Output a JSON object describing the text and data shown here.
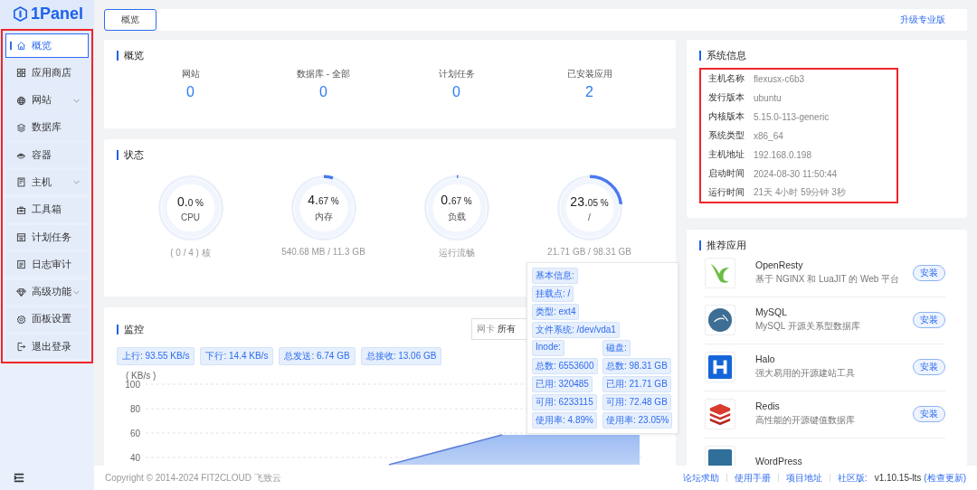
{
  "brand": {
    "name": "1Panel"
  },
  "sidebar": {
    "highlighted": true,
    "items": [
      {
        "label": "概览",
        "selected": true,
        "expandable": false
      },
      {
        "label": "应用商店",
        "selected": false,
        "expandable": false
      },
      {
        "label": "网站",
        "selected": false,
        "expandable": true
      },
      {
        "label": "数据库",
        "selected": false,
        "expandable": false
      },
      {
        "label": "容器",
        "selected": false,
        "expandable": false
      },
      {
        "label": "主机",
        "selected": false,
        "expandable": true
      },
      {
        "label": "工具箱",
        "selected": false,
        "expandable": false
      },
      {
        "label": "计划任务",
        "selected": false,
        "expandable": false
      },
      {
        "label": "日志审计",
        "selected": false,
        "expandable": false
      },
      {
        "label": "高级功能",
        "selected": false,
        "expandable": true
      },
      {
        "label": "面板设置",
        "selected": false,
        "expandable": false
      },
      {
        "label": "退出登录",
        "selected": false,
        "expandable": false
      }
    ]
  },
  "topbar": {
    "tabs": [
      {
        "label": "概览",
        "selected": true
      }
    ],
    "upgrade_link": "升级专业版"
  },
  "overview": {
    "title": "概览",
    "stats": [
      {
        "label": "网站",
        "value": "0"
      },
      {
        "label": "数据库 - 全部",
        "value": "0"
      },
      {
        "label": "计划任务",
        "value": "0"
      },
      {
        "label": "已安装应用",
        "value": "2"
      }
    ]
  },
  "status": {
    "title": "状态",
    "gauges": [
      {
        "major": "0.",
        "minor": "0 %",
        "label": "CPU",
        "level": 0.0,
        "detail": "( 0 / 4 ) 核"
      },
      {
        "major": "4.",
        "minor": "67 %",
        "label": "内存",
        "level": 0.0467,
        "detail": "540.68 MB / 11.3 GB"
      },
      {
        "major": "0.",
        "minor": "67 %",
        "label": "负载",
        "level": 0.0067,
        "detail": "运行流畅"
      },
      {
        "major": "23.",
        "minor": "05 %",
        "label": "/",
        "level": 0.2305,
        "detail": "21.71 GB / 98.31 GB"
      }
    ]
  },
  "disk_tooltip": {
    "rows": [
      [
        "基本信息:"
      ],
      [
        "挂载点: /"
      ],
      [
        "类型: ext4"
      ],
      [
        "文件系统: /dev/vda1"
      ],
      [
        "Inode:",
        "磁盘:"
      ],
      [
        "总数: 6553600",
        "总数: 98.31 GB"
      ],
      [
        "已用: 320485",
        "已用: 21.71 GB"
      ],
      [
        "可用: 6233115",
        "可用: 72.48 GB"
      ],
      [
        "使用率: 4.89%",
        "使用率: 23.05%"
      ]
    ]
  },
  "monitor": {
    "title": "监控",
    "select_label": "网卡",
    "select_value": "所有",
    "tags": [
      "上行: 93.55 KB/s",
      "下行: 14.4 KB/s",
      "总发送: 6.74 GB",
      "总接收: 13.06 GB"
    ],
    "y_unit": "( KB/s )",
    "y_ticks": [
      "100",
      "80",
      "60",
      "40"
    ]
  },
  "system_info": {
    "title": "系统信息",
    "highlighted": true,
    "rows": [
      {
        "label": "主机名称",
        "value": "flexusx-c6b3"
      },
      {
        "label": "发行版本",
        "value": "ubuntu"
      },
      {
        "label": "内核版本",
        "value": "5.15.0-113-generic"
      },
      {
        "label": "系统类型",
        "value": "x86_64"
      },
      {
        "label": "主机地址",
        "value": "192.168.0.198"
      },
      {
        "label": "启动时间",
        "value": "2024-08-30 11:50:44"
      },
      {
        "label": "运行时间",
        "value": "21天 4小时 59分钟 3秒"
      }
    ]
  },
  "recommended": {
    "title": "推荐应用",
    "apps": [
      {
        "name": "OpenResty",
        "description": "基于 NGINX 和 LuaJIT 的 Web 平台",
        "button": "安装"
      },
      {
        "name": "MySQL",
        "description": "MySQL 开源关系型数据库",
        "button": "安装"
      },
      {
        "name": "Halo",
        "description": "强大易用的开源建站工具",
        "button": "安装"
      },
      {
        "name": "Redis",
        "description": "高性能的开源键值数据库",
        "button": "安装"
      },
      {
        "name": "WordPress"
      }
    ]
  },
  "footer": {
    "copyright": "Copyright © 2014-2024 FIT2CLOUD 飞致云",
    "links": [
      "论坛求助",
      "使用手册",
      "项目地址"
    ],
    "edition": "社区版:",
    "version": "v1.10.15-lts",
    "update_link": "(检查更新)"
  }
}
